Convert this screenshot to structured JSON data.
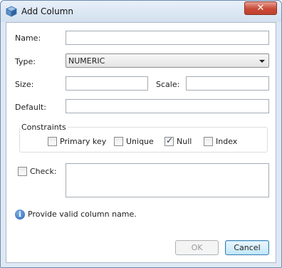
{
  "window": {
    "title": "Add Column",
    "close_glyph": "✕"
  },
  "form": {
    "name_label": "Name:",
    "name_value": "",
    "type_label": "Type:",
    "type_value": "NUMERIC",
    "size_label": "Size:",
    "size_value": "",
    "scale_label": "Scale:",
    "scale_value": "",
    "default_label": "Default:",
    "default_value": ""
  },
  "constraints": {
    "title": "Constraints",
    "primary_key": {
      "label": "Primary key",
      "checked": false
    },
    "unique": {
      "label": "Unique",
      "checked": false
    },
    "null": {
      "label": "Null",
      "checked": true
    },
    "index": {
      "label": "Index",
      "checked": false
    }
  },
  "check": {
    "label": "Check:",
    "checked": false,
    "value": ""
  },
  "message": {
    "icon": "info-icon",
    "text": "Provide valid column name."
  },
  "buttons": {
    "ok_label": "OK",
    "ok_enabled": false,
    "cancel_label": "Cancel"
  },
  "colors": {
    "accent": "#3c7fb1",
    "close_button": "#c84a35",
    "info": "#2a66b8"
  }
}
